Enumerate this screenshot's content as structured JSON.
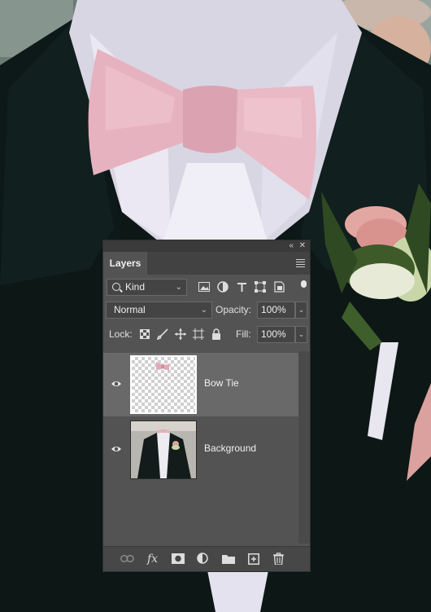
{
  "panel": {
    "tab_label": "Layers",
    "filter": {
      "kind_label": "Kind"
    },
    "blend_mode": "Normal",
    "opacity_label": "Opacity:",
    "opacity_value": "100%",
    "lock_label": "Lock:",
    "fill_label": "Fill:",
    "fill_value": "100%"
  },
  "layers": [
    {
      "name": "Bow Tie",
      "visible": true,
      "selected": true,
      "thumbnail": "transparent-with-bowtie"
    },
    {
      "name": "Background",
      "visible": true,
      "selected": false,
      "thumbnail": "groom-photo"
    }
  ],
  "icons": {
    "top_bar": [
      "collapse-icon",
      "close-icon"
    ],
    "filter": [
      "pixel-filter-icon",
      "adjustment-filter-icon",
      "type-filter-icon",
      "shape-filter-icon",
      "smart-object-filter-icon",
      "filter-toggle-icon"
    ],
    "lock": [
      "lock-transparent-pixels-icon",
      "lock-image-pixels-icon",
      "lock-position-icon",
      "lock-artboard-icon",
      "lock-all-icon"
    ],
    "bottom": [
      "link-layers-icon",
      "layer-style-icon",
      "layer-mask-icon",
      "adjustment-layer-icon",
      "group-icon",
      "new-layer-icon",
      "delete-layer-icon"
    ]
  },
  "colors": {
    "panel_bg": "#535353",
    "selected_layer_bg": "#696969",
    "bowtie_pink": "#eab9c4",
    "suit_black": "#0e1b1a"
  }
}
